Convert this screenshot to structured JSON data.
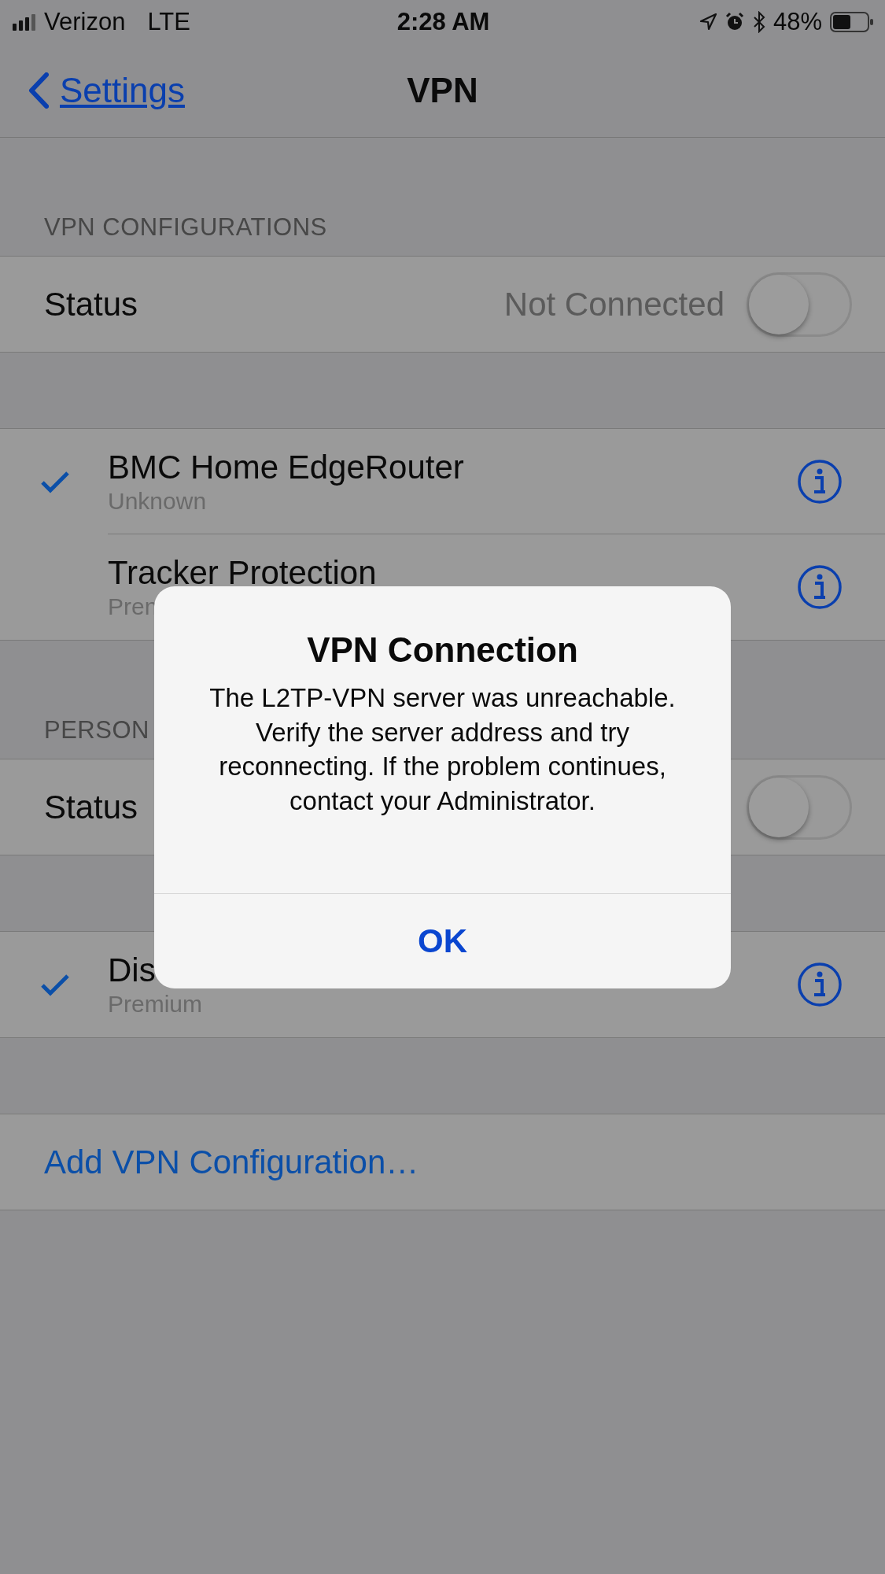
{
  "status_bar": {
    "carrier": "Verizon",
    "network": "LTE",
    "time": "2:28 AM",
    "battery": "48%"
  },
  "nav": {
    "back": "Settings",
    "title": "VPN"
  },
  "sections": [
    {
      "header": "VPN CONFIGURATIONS",
      "status": {
        "label": "Status",
        "value": "Not Connected",
        "on": false
      },
      "configurations": [
        {
          "name": "BMC Home EdgeRouter",
          "subtitle": "Unknown",
          "selected": true
        },
        {
          "name": "Tracker Protection",
          "subtitle": "Pren",
          "selected": false
        }
      ]
    },
    {
      "header": "PERSON",
      "status": {
        "label": "Status",
        "on": false
      },
      "configurations": [
        {
          "name": "Dis",
          "subtitle": "Premium",
          "selected": true
        }
      ]
    }
  ],
  "add_button": "Add VPN Configuration…",
  "alert": {
    "title": "VPN Connection",
    "message": "The L2TP-VPN server was unreachable. Verify the server address and try reconnecting. If the problem continues, contact your Administrator.",
    "button": "OK"
  }
}
